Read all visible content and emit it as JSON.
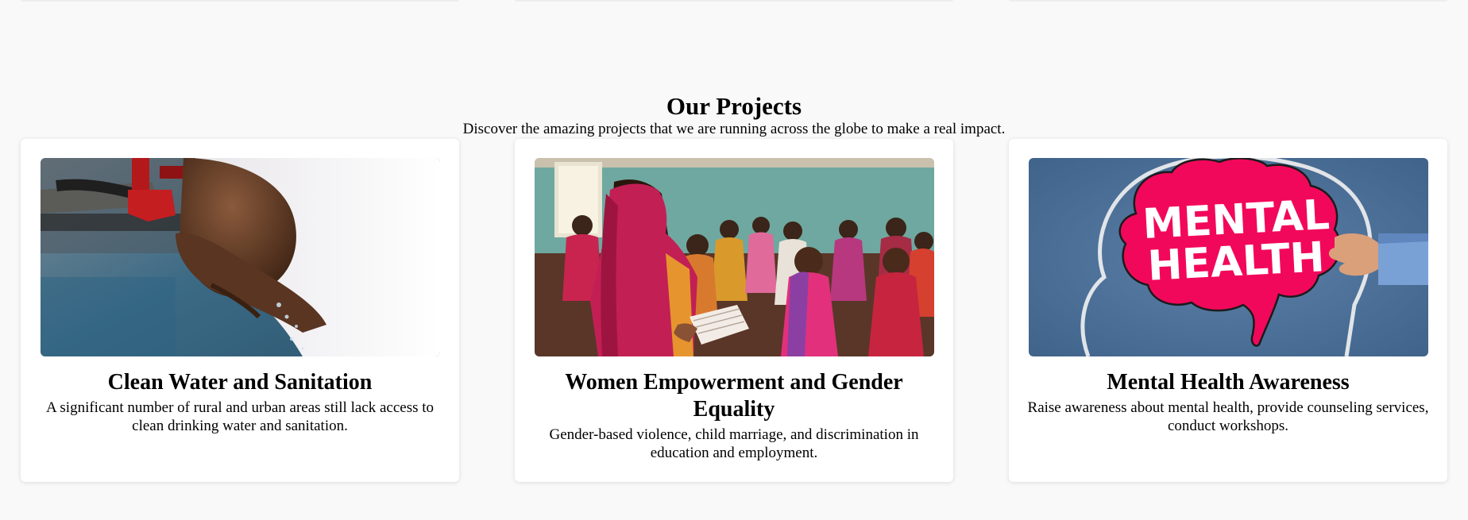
{
  "section": {
    "title": "Our Projects",
    "subtitle": "Discover the amazing projects that we are running across the globe to make a real impact."
  },
  "projects": [
    {
      "title": "Clean Water and Sanitation",
      "description": "A significant number of rural and urban areas still lack access to clean drinking water and sanitation.",
      "image": "child-drinking-from-tap-photo"
    },
    {
      "title": "Women Empowerment and Gender Equality",
      "description": "Gender-based violence, child marriage, and discrimination in education and employment.",
      "image": "women-group-classroom-photo"
    },
    {
      "title": "Mental Health Awareness",
      "description": "Raise awareness about mental health, provide counseling services, conduct workshops.",
      "image": "mental-health-brain-sign-photo",
      "image_text": "MENTAL HEALTH"
    }
  ],
  "colors": {
    "page_background": "#f9f9f9",
    "card_background": "#ffffff",
    "accent_pink": "#f2085a",
    "chalkboard_blue": "#4a6d94"
  }
}
